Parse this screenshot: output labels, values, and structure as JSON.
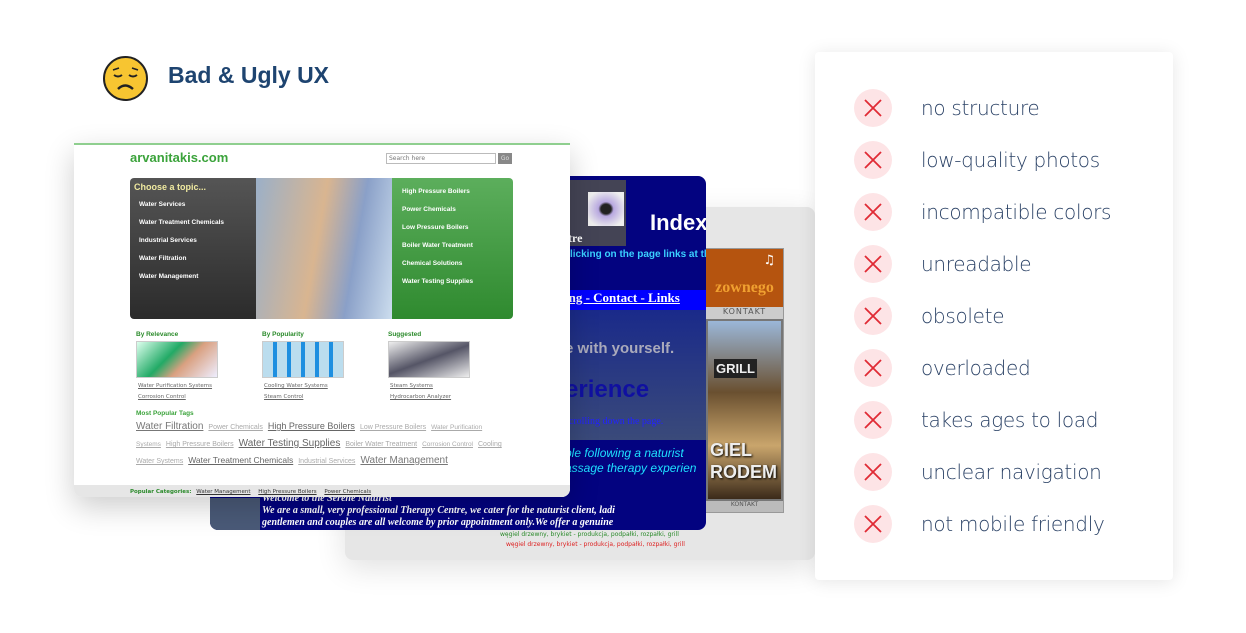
{
  "header": {
    "title": "Bad & Ugly UX",
    "icon": "disappointed-face-emoji"
  },
  "colors": {
    "title": "#1e4470",
    "x_mark": "#e02b35",
    "x_bg": "#fde4e6",
    "green": "#3ba33b"
  },
  "site1": {
    "name": "arvanitakis.com",
    "search_placeholder": "Search here",
    "go": "Go",
    "choose": "Choose a topic...",
    "left_menu": [
      "Water Services",
      "Water Treatment Chemicals",
      "Industrial Services",
      "Water Filtration",
      "Water Management"
    ],
    "right_menu": [
      "High Pressure Boilers",
      "Power Chemicals",
      "Low Pressure Boilers",
      "Boiler Water Treatment",
      "Chemical Solutions",
      "Water Testing Supplies"
    ],
    "columns": [
      {
        "title": "By Relevance",
        "links": [
          "Water Purification Systems",
          "Corrosion Control"
        ]
      },
      {
        "title": "By Popularity",
        "links": [
          "Cooling Water Systems",
          "Steam Control"
        ]
      },
      {
        "title": "Suggested",
        "links": [
          "Steam Systems",
          "Hydrocarbon Analyzer"
        ]
      }
    ],
    "tags_title": "Most Popular Tags",
    "tags": [
      "Water Filtration",
      "Power Chemicals",
      "High Pressure Boilers",
      "Low Pressure Boilers",
      "Water Purification Systems",
      "High Pressure Boilers",
      "Water Testing Supplies",
      "Boiler Water Treatment",
      "Corrosion Control",
      "Cooling Water Systems",
      "Water Treatment Chemicals",
      "Industrial Services",
      "Water Management"
    ],
    "footer_label": "Popular Categories:",
    "footer_links": [
      "Water Management",
      "High Pressure Boilers",
      "Power Chemicals"
    ]
  },
  "site2": {
    "index": "Index",
    "tre": "tre",
    "click": "licking on the page links at th",
    "nav": "ing  - Contact -  Links",
    "with": "e with yourself.",
    "erience": "erience",
    "scroll": "scrolling down the page.",
    "p1": "ple following a naturist",
    "p2": "assage therapy experien",
    "welcome": "Welcome to the Serene Naturist",
    "w1": "We are a small, very professional  Therapy Centre, we cater for  the  naturist  client, ladi",
    "w2": "gentlemen and couples are all welcome by prior appointment only.We offer a genuine"
  },
  "site3": {
    "logo": "zownego",
    "kontakt": "KONTAKT",
    "grill": "GRILL",
    "wegiel1": "GIEL",
    "wegiel2": "RODEM",
    "kontakt_footer": "KONTAKT",
    "caption1": "węgiel drzewny, brykiet - produkcja, podpałki, rozpałki, grill",
    "caption2": "węgiel drzewny, brykiet - produkcja, podpałki, rozpałki, grill"
  },
  "issues": [
    "no structure",
    "low-quality photos",
    "incompatible colors",
    "unreadable",
    "obsolete",
    "overloaded",
    "takes ages to load",
    "unclear navigation",
    "not mobile friendly"
  ]
}
